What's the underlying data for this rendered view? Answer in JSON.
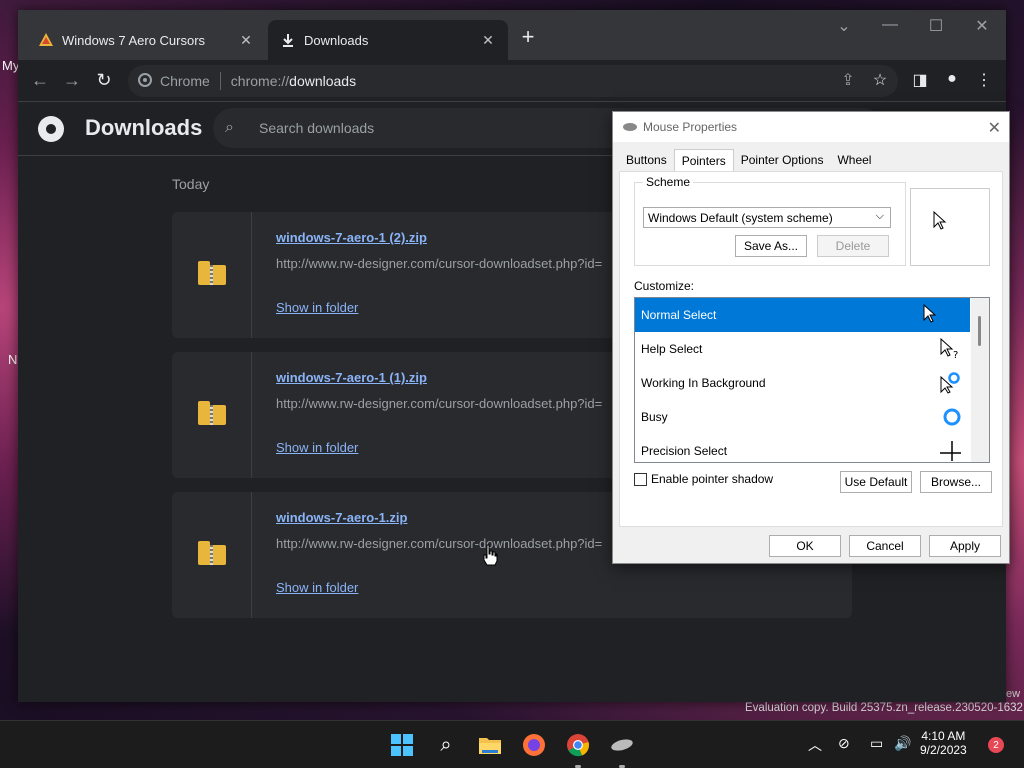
{
  "desktop": {
    "frag1": "My",
    "frag2": "N",
    "eval_text": "Evaluation copy. Build 25375.zn_release.230520-1632",
    "eval_frag": "ew"
  },
  "chrome": {
    "tabs": [
      {
        "title": "Windows 7 Aero Cursors",
        "close": "✕"
      },
      {
        "title": "Downloads",
        "close": "✕"
      }
    ],
    "new_tab": "+",
    "window_controls": {
      "dropdown": "⌄",
      "minimize": "—",
      "maximize": "☐",
      "close": "✕"
    },
    "omnibox": {
      "site_label": "Chrome",
      "scheme": "chrome://",
      "host": "downloads"
    },
    "icons": [
      "back-icon",
      "forward-icon",
      "reload-icon",
      "share-icon",
      "star-icon",
      "side-panel-icon",
      "profile-icon",
      "menu-icon"
    ]
  },
  "downloads": {
    "title": "Downloads",
    "search_placeholder": "Search downloads",
    "section": "Today",
    "items": [
      {
        "file": "windows-7-aero-1 (2).zip",
        "url": "http://www.rw-designer.com/cursor-downloadset.php?id=",
        "action": "Show in folder"
      },
      {
        "file": "windows-7-aero-1 (1).zip",
        "url": "http://www.rw-designer.com/cursor-downloadset.php?id=",
        "action": "Show in folder"
      },
      {
        "file": "windows-7-aero-1.zip",
        "url": "http://www.rw-designer.com/cursor-downloadset.php?id=",
        "action": "Show in folder"
      }
    ]
  },
  "mouse_dialog": {
    "title": "Mouse Properties",
    "close": "✕",
    "tabs": [
      "Buttons",
      "Pointers",
      "Pointer Options",
      "Wheel"
    ],
    "selected_tab": "Pointers",
    "scheme_label": "Scheme",
    "scheme_value": "Windows Default (system scheme)",
    "save_as": "Save As...",
    "delete": "Delete",
    "customize_label": "Customize:",
    "pointers": [
      {
        "name": "Normal Select",
        "icon": "arrow-cursor-icon"
      },
      {
        "name": "Help Select",
        "icon": "help-cursor-icon"
      },
      {
        "name": "Working In Background",
        "icon": "working-cursor-icon"
      },
      {
        "name": "Busy",
        "icon": "busy-cursor-icon"
      },
      {
        "name": "Precision Select",
        "icon": "crosshair-cursor-icon"
      }
    ],
    "selected_pointer": "Normal Select",
    "shadow_label": "Enable pointer shadow",
    "use_default": "Use Default",
    "browse": "Browse...",
    "ok": "OK",
    "cancel": "Cancel",
    "apply": "Apply"
  },
  "taskbar": {
    "time": "4:10 AM",
    "date": "9/2/2023",
    "notification_count": "2",
    "apps": [
      "start-icon",
      "search-icon",
      "file-explorer-icon",
      "firefox-icon",
      "chrome-icon",
      "mouse-icon"
    ],
    "tray": {
      "chevron": "︿",
      "volume": "🔊"
    }
  },
  "colors": {
    "link": "#8ab4f8",
    "selection": "#0078d7",
    "chrome_bg": "#202124"
  }
}
